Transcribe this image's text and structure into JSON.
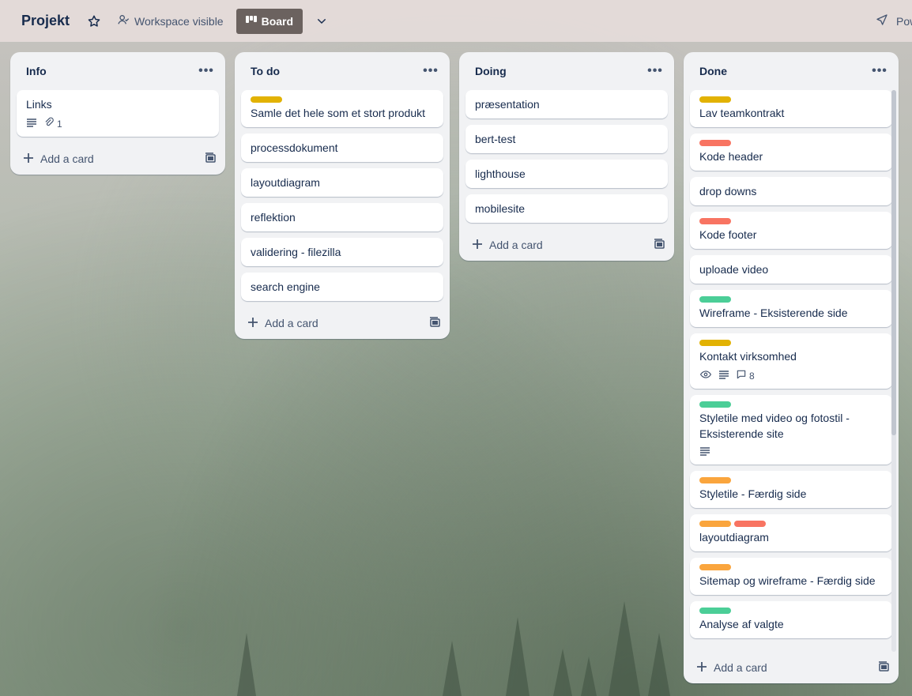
{
  "header": {
    "board_title": "Projekt",
    "visibility_label": "Workspace visible",
    "view_label": "Board",
    "power_label": "Pow"
  },
  "add_card_label": "Add a card",
  "label_colors": {
    "yellow": "#e2b203",
    "red": "#f87462",
    "green": "#4bce97",
    "orange": "#faa53d"
  },
  "lists": [
    {
      "title": "Info",
      "cards": [
        {
          "title": "Links",
          "labels": [],
          "badges": {
            "description": true,
            "attachments": "1"
          }
        }
      ]
    },
    {
      "title": "To do",
      "cards": [
        {
          "title": "Samle det hele som et stort produkt",
          "labels": [
            "yellow"
          ]
        },
        {
          "title": "processdokument",
          "labels": []
        },
        {
          "title": "layoutdiagram",
          "labels": []
        },
        {
          "title": "reflektion",
          "labels": []
        },
        {
          "title": "validering - filezilla",
          "labels": []
        },
        {
          "title": "search engine",
          "labels": []
        }
      ]
    },
    {
      "title": "Doing",
      "cards": [
        {
          "title": "præsentation",
          "labels": []
        },
        {
          "title": "bert-test",
          "labels": []
        },
        {
          "title": "lighthouse",
          "labels": []
        },
        {
          "title": "mobilesite",
          "labels": []
        }
      ]
    },
    {
      "title": "Done",
      "cards": [
        {
          "title": "Lav teamkontrakt",
          "labels": [
            "yellow"
          ]
        },
        {
          "title": "Kode header",
          "labels": [
            "red"
          ]
        },
        {
          "title": "drop downs",
          "labels": []
        },
        {
          "title": "Kode footer",
          "labels": [
            "red"
          ]
        },
        {
          "title": "uploade video",
          "labels": []
        },
        {
          "title": "Wireframe - Eksisterende side",
          "labels": [
            "green"
          ]
        },
        {
          "title": "Kontakt virksomhed",
          "labels": [
            "yellow"
          ],
          "badges": {
            "watching": true,
            "description": true,
            "comments": "8"
          }
        },
        {
          "title": "Styletile med video og fotostil - Eksisterende site",
          "labels": [
            "green"
          ],
          "badges": {
            "description": true
          }
        },
        {
          "title": "Styletile - Færdig side",
          "labels": [
            "orange"
          ]
        },
        {
          "title": "layoutdiagram",
          "labels": [
            "orange",
            "red"
          ]
        },
        {
          "title": "Sitemap og wireframe - Færdig side",
          "labels": [
            "orange"
          ]
        },
        {
          "title": "Analyse af valgte",
          "labels": [
            "green"
          ]
        }
      ]
    }
  ]
}
